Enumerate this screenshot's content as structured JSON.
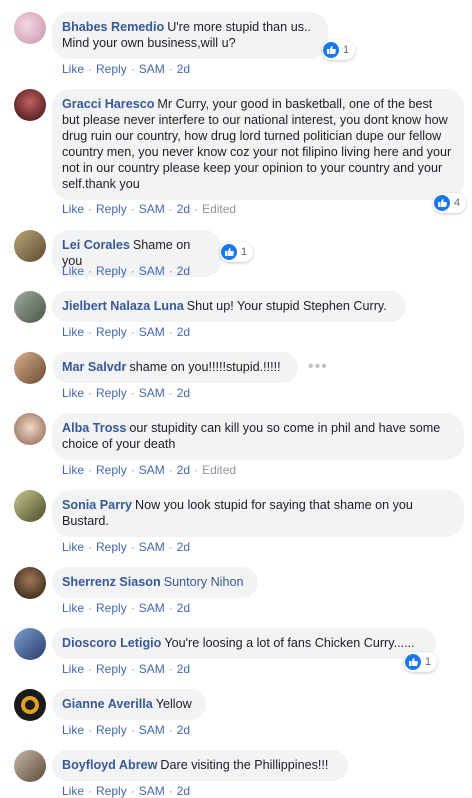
{
  "comments": [
    {
      "author": "Bhabes Remedio",
      "text": "U're more stupid than us.. Mind your own business,will u?",
      "likes": "1",
      "actions": {
        "like": "Like",
        "reply": "Reply",
        "sam": "SAM",
        "time": "2d"
      },
      "avatar_color": "#d8b4c8"
    },
    {
      "author": "Gracci Haresco",
      "text": "Mr Curry, your good in basketball, one of the best but please never interfere to our national interest, you dont know how drug ruin our country, how drug lord turned politician dupe our fellow country men, you never know coz your not filipino living here and your not in our country please keep your opinion to your country and your self.thank you",
      "likes": "4",
      "actions": {
        "like": "Like",
        "reply": "Reply",
        "sam": "SAM",
        "time": "2d",
        "edited": "Edited"
      },
      "avatar_color": "#6b2a2a"
    },
    {
      "author": "Lei Corales",
      "text": "Shame on you",
      "likes": "1",
      "actions": {
        "like": "Like",
        "reply": "Reply",
        "sam": "SAM",
        "time": "2d"
      },
      "avatar_color": "#8a7a56"
    },
    {
      "author": "Jielbert Nalaza Luna",
      "text": "Shut up! Your stupid Stephen Curry.",
      "actions": {
        "like": "Like",
        "reply": "Reply",
        "sam": "SAM",
        "time": "2d"
      },
      "avatar_color": "#7a8478"
    },
    {
      "author": "Mar Salvdr",
      "text": "shame on you!!!!!stupid.!!!!!",
      "more": "•••",
      "actions": {
        "like": "Like",
        "reply": "Reply",
        "sam": "SAM",
        "time": "2d"
      },
      "avatar_color": "#b08866"
    },
    {
      "author": "Alba Tross",
      "text": "our stupidity can kill you so come in phil and have some choice of your death",
      "actions": {
        "like": "Like",
        "reply": "Reply",
        "sam": "SAM",
        "time": "2d",
        "edited": "Edited"
      },
      "avatar_color": "#c8a890"
    },
    {
      "author": "Sonia Parry",
      "text": "Now you look stupid for saying that shame on you Bustard.",
      "actions": {
        "like": "Like",
        "reply": "Reply",
        "sam": "SAM",
        "time": "2d"
      },
      "avatar_color": "#8a8a5a"
    },
    {
      "author": "Sherrenz Siason",
      "text": "Suntory Nihon",
      "actions": {
        "like": "Like",
        "reply": "Reply",
        "sam": "SAM",
        "time": "2d"
      },
      "avatar_color": "#5a4a3a"
    },
    {
      "author": "Dioscoro Letigio",
      "text": "You're loosing a lot of fans Chicken Curry......",
      "likes": "1",
      "actions": {
        "like": "Like",
        "reply": "Reply",
        "sam": "SAM",
        "time": "2d"
      },
      "avatar_color": "#4a6a9a"
    },
    {
      "author": "Gianne Averilla",
      "text": "Yellow",
      "actions": {
        "like": "Like",
        "reply": "Reply",
        "sam": "SAM",
        "time": "2d"
      },
      "avatar_color": "#d9a030"
    },
    {
      "author": "Boyfloyd Abrew",
      "text": "Dare visiting the Phillippines!!!",
      "actions": {
        "like": "Like",
        "reply": "Reply",
        "sam": "SAM",
        "time": "2d"
      },
      "avatar_color": "#9a8a7a"
    }
  ],
  "colors": {
    "link": "#385898",
    "action": "#4267b2",
    "muted": "#90949c",
    "bubble": "#f2f3f5",
    "like": "#1877f2"
  },
  "icons": {
    "like": "thumbs-up-icon",
    "more": "more-options-icon"
  }
}
